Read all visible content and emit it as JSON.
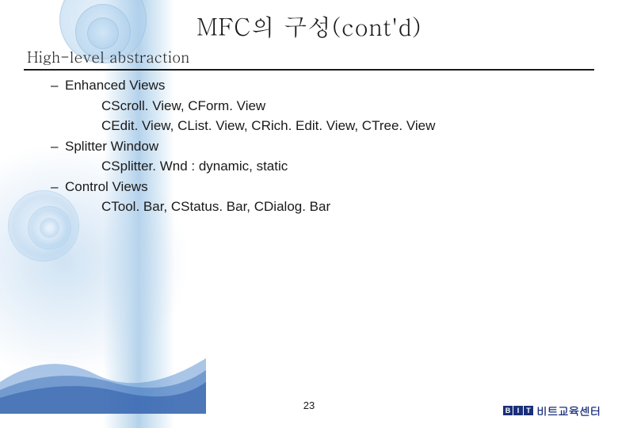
{
  "title": "MFC의 구성(cont'd)",
  "section": "High-level abstraction",
  "items": [
    {
      "label": "Enhanced Views",
      "sub": [
        "CScroll. View, CForm. View",
        "CEdit. View, CList. View, CRich. Edit. View, CTree. View"
      ]
    },
    {
      "label": "Splitter Window",
      "sub": [
        "CSplitter. Wnd : dynamic, static"
      ]
    },
    {
      "label": "Control Views",
      "sub": [
        "CTool. Bar, CStatus. Bar, CDialog. Bar"
      ]
    }
  ],
  "page": "23",
  "brand": {
    "logo": [
      "B",
      "I",
      "T"
    ],
    "text": "비트교육센터"
  }
}
